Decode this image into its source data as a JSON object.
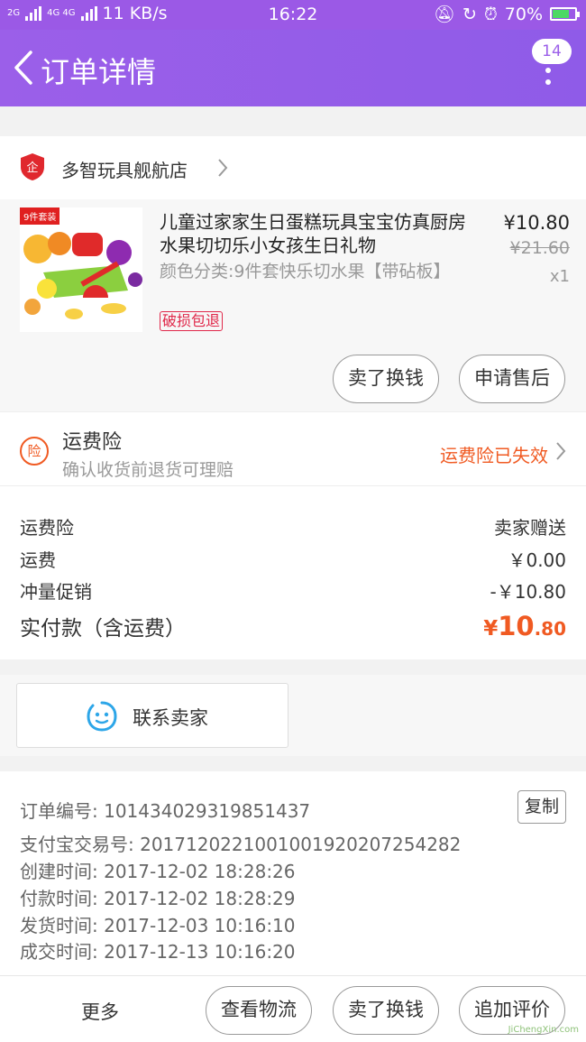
{
  "status_bar": {
    "signal_left": "2G",
    "signal_mid": "4G 4G",
    "speed": "11 KB/s",
    "time": "16:22",
    "battery": "70%",
    "battery_level": 0.7
  },
  "navbar": {
    "title": "订单详情",
    "message_count": "14"
  },
  "store": {
    "name": "多智玩具舰航店",
    "logo_text": "企"
  },
  "product": {
    "image_tag": "9件套装",
    "title": "儿童过家家生日蛋糕玩具宝宝仿真厨房 水果切切乐小女孩生日礼物",
    "spec": "颜色分类:9件套快乐切水果【带砧板】",
    "badge": "破损包退",
    "price": "¥10.80",
    "old_price": "¥21.60",
    "quantity": "x1",
    "sell_button": "卖了换钱",
    "aftersale_button": "申请售后"
  },
  "insurance": {
    "icon_text": "险",
    "title": "运费险",
    "subtitle": "确认收货前退货可理赔",
    "status": "运费险已失效"
  },
  "costs": {
    "rows": [
      {
        "label": "运费险",
        "value": "卖家赠送"
      },
      {
        "label": "运费",
        "value": "￥0.00"
      },
      {
        "label": "冲量促销",
        "value": "-￥10.80"
      }
    ],
    "total_label": "实付款（含运费）",
    "total_currency": "¥",
    "total_int": "10",
    "total_dec": ".80"
  },
  "contact": {
    "label": "联系卖家"
  },
  "order_info": {
    "order_no": "订单编号: 101434029319851437",
    "alipay_no": "支付宝交易号: 2017120221001001920207254282",
    "created": "创建时间: 2017-12-02 18:28:26",
    "paid": "付款时间: 2017-12-02 18:28:29",
    "shipped": "发货时间: 2017-12-03 10:16:10",
    "completed": "成交时间: 2017-12-13 10:16:20",
    "copy_button": "复制"
  },
  "bottom_bar": {
    "more": "更多",
    "logistics": "查看物流",
    "sell": "卖了换钱",
    "review": "追加评价"
  },
  "watermark": "JiChengXin.com"
}
